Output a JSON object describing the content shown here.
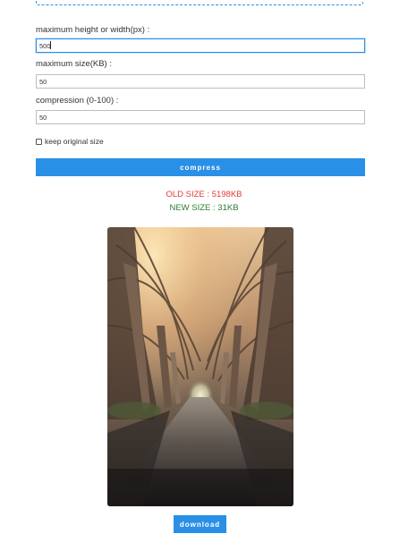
{
  "form": {
    "max_dimension": {
      "label": "maximum height or width(px) :",
      "value": "500"
    },
    "max_size": {
      "label": "maximum size(KB) :",
      "value": "50"
    },
    "compression": {
      "label": "compression (0-100) :",
      "value": "50"
    },
    "keep_original": {
      "label": "keep original size",
      "checked": false
    },
    "compress_label": "compress"
  },
  "result": {
    "old_size": "OLD SIZE : 5198KB",
    "new_size": "NEW SIZE : 31KB",
    "preview_image": "forest-path-tree-tunnel-photo",
    "download_label": "download"
  },
  "colors": {
    "accent": "#2a8fe6",
    "old_size": "#e53935",
    "new_size": "#2e7d32"
  }
}
